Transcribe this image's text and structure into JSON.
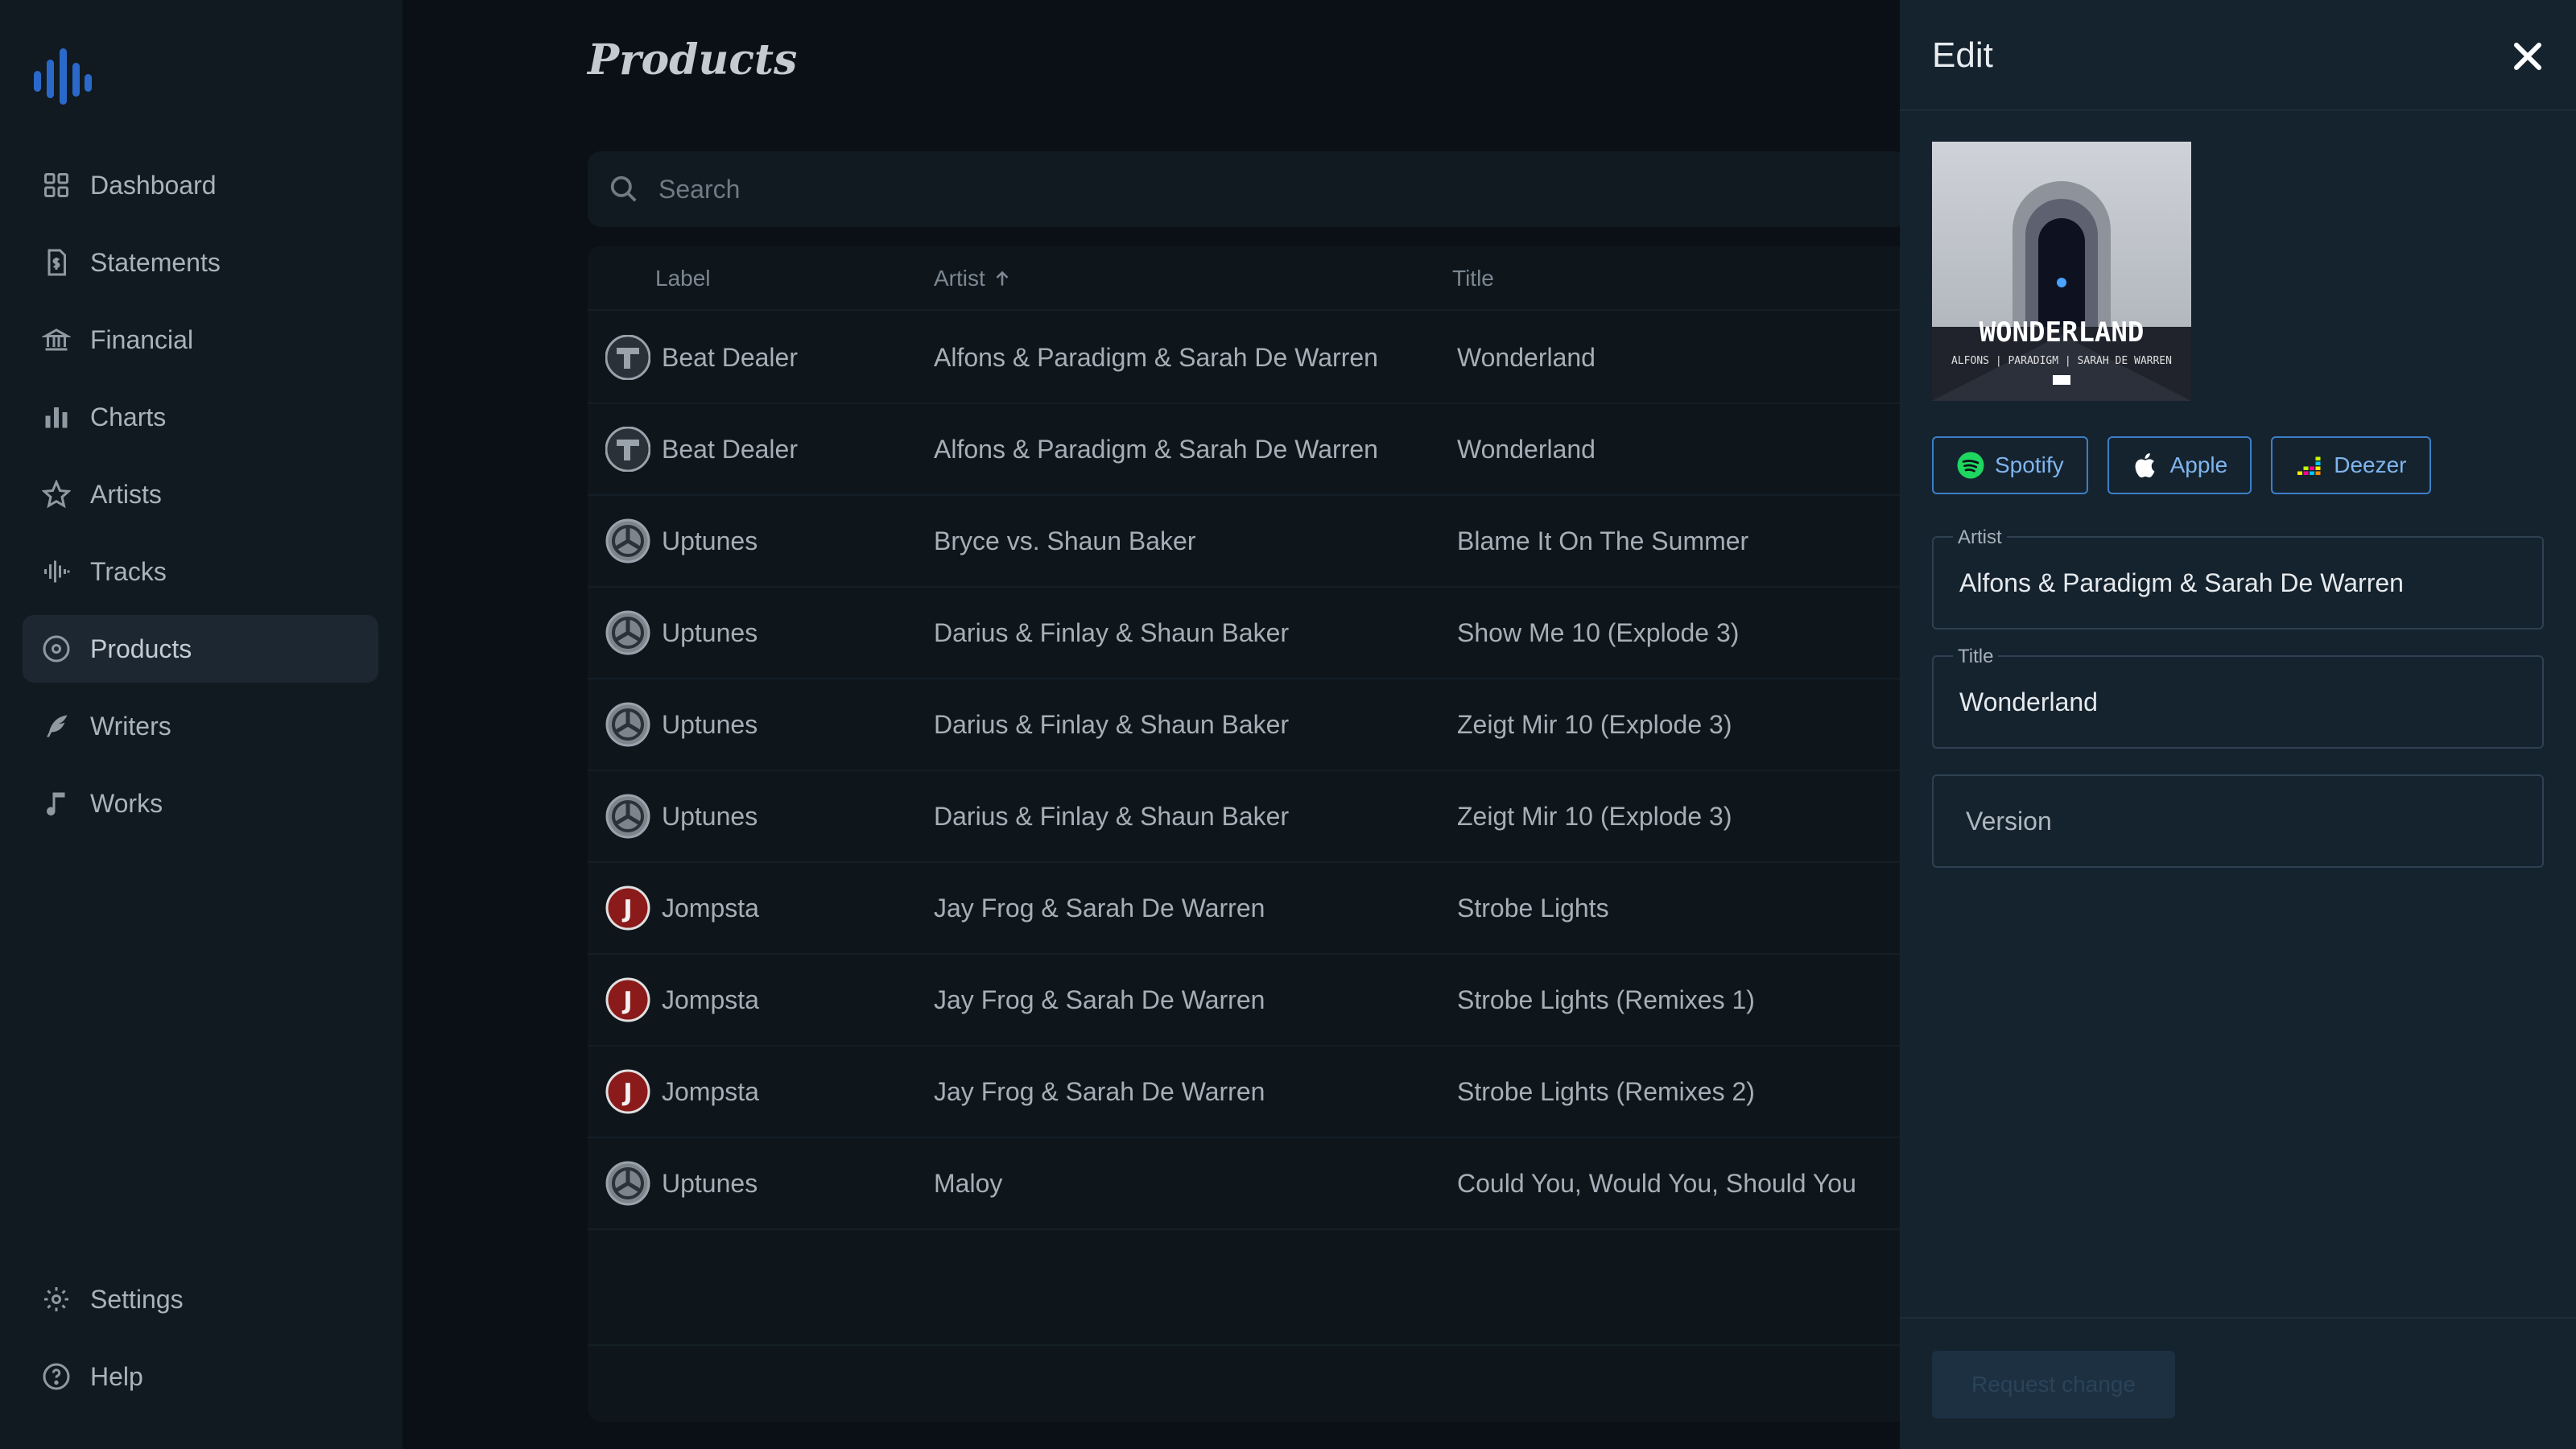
{
  "sidebar": {
    "items": [
      {
        "label": "Dashboard",
        "icon": "grid-icon"
      },
      {
        "label": "Statements",
        "icon": "document-dollar-icon"
      },
      {
        "label": "Financial",
        "icon": "bank-icon"
      },
      {
        "label": "Charts",
        "icon": "bar-chart-icon"
      },
      {
        "label": "Artists",
        "icon": "star-icon"
      },
      {
        "label": "Tracks",
        "icon": "waveform-icon"
      },
      {
        "label": "Products",
        "icon": "disc-icon",
        "active": true
      },
      {
        "label": "Writers",
        "icon": "feather-icon"
      },
      {
        "label": "Works",
        "icon": "music-note-icon"
      }
    ],
    "bottom": [
      {
        "label": "Settings",
        "icon": "gear-icon"
      },
      {
        "label": "Help",
        "icon": "help-circle-icon"
      }
    ]
  },
  "main": {
    "title": "Products",
    "search_placeholder": "Search",
    "columns": {
      "label": "Label",
      "artist": "Artist",
      "title": "Title"
    },
    "rows": [
      {
        "label": "Beat Dealer",
        "logo": "beat-dealer",
        "artist": "Alfons & Paradigm & Sarah De Warren",
        "title": "Wonderland"
      },
      {
        "label": "Beat Dealer",
        "logo": "beat-dealer",
        "artist": "Alfons & Paradigm & Sarah De Warren",
        "title": "Wonderland"
      },
      {
        "label": "Uptunes",
        "logo": "uptunes",
        "artist": "Bryce vs. Shaun Baker",
        "title": "Blame It On The Summer"
      },
      {
        "label": "Uptunes",
        "logo": "uptunes",
        "artist": "Darius & Finlay & Shaun Baker",
        "title": "Show Me 10 (Explode 3)"
      },
      {
        "label": "Uptunes",
        "logo": "uptunes",
        "artist": "Darius & Finlay & Shaun Baker",
        "title": "Zeigt Mir 10 (Explode 3)"
      },
      {
        "label": "Uptunes",
        "logo": "uptunes",
        "artist": "Darius & Finlay & Shaun Baker",
        "title": "Zeigt Mir 10 (Explode 3)"
      },
      {
        "label": "Jompsta",
        "logo": "jompsta",
        "artist": "Jay Frog & Sarah De Warren",
        "title": "Strobe Lights"
      },
      {
        "label": "Jompsta",
        "logo": "jompsta",
        "artist": "Jay Frog & Sarah De Warren",
        "title": "Strobe Lights (Remixes 1)"
      },
      {
        "label": "Jompsta",
        "logo": "jompsta",
        "artist": "Jay Frog & Sarah De Warren",
        "title": "Strobe Lights (Remixes 2)"
      },
      {
        "label": "Uptunes",
        "logo": "uptunes",
        "artist": "Maloy",
        "title": "Could You, Would You, Should You"
      }
    ]
  },
  "edit": {
    "title": "Edit",
    "cover": {
      "title": "WONDERLAND",
      "subtitle": "ALFONS | PARADIGM | SARAH DE WARREN"
    },
    "services": [
      {
        "label": "Spotify",
        "icon": "spotify-icon"
      },
      {
        "label": "Apple",
        "icon": "apple-icon"
      },
      {
        "label": "Deezer",
        "icon": "deezer-icon"
      }
    ],
    "fields": {
      "artist": {
        "label": "Artist",
        "value": "Alfons & Paradigm & Sarah De Warren"
      },
      "title": {
        "label": "Title",
        "value": "Wonderland"
      },
      "version": {
        "placeholder": "Version"
      }
    },
    "submit_label": "Request change"
  },
  "colors": {
    "accent": "#3d7fc7",
    "background": "#0a1015",
    "panel": "#15232f"
  }
}
